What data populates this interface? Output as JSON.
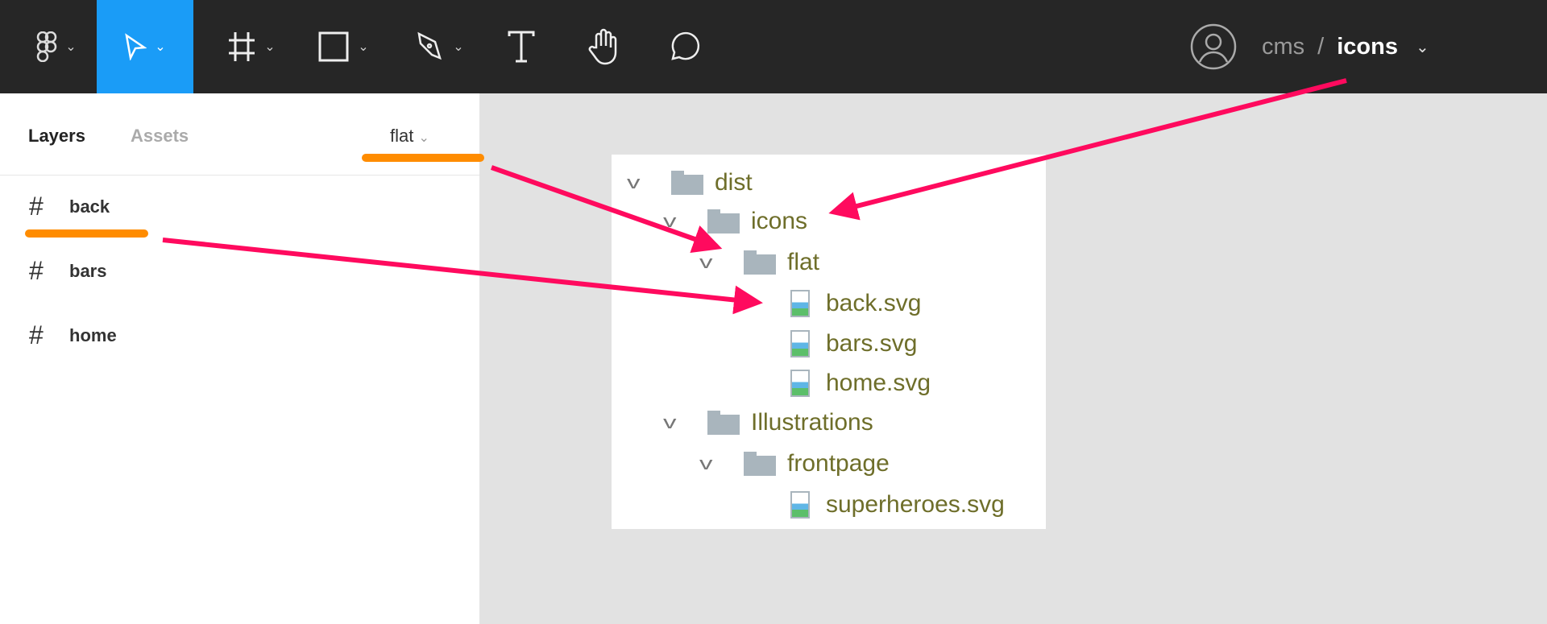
{
  "toolbar": {
    "tools": [
      {
        "name": "figma-menu",
        "icon": "figma-logo-icon"
      },
      {
        "name": "move",
        "icon": "cursor-icon",
        "active": true
      },
      {
        "name": "frame",
        "icon": "frame-hash-icon"
      },
      {
        "name": "rectangle",
        "icon": "rectangle-icon"
      },
      {
        "name": "pen",
        "icon": "pen-icon"
      },
      {
        "name": "text",
        "icon": "text-icon"
      },
      {
        "name": "hand",
        "icon": "hand-icon"
      },
      {
        "name": "comment",
        "icon": "comment-icon"
      }
    ],
    "accent": "#1a9cf7"
  },
  "breadcrumb": {
    "team": "cms",
    "separator": "/",
    "file": "icons"
  },
  "left_panel": {
    "tabs": {
      "layers": "Layers",
      "assets": "Assets"
    },
    "page_select": "flat",
    "layers": [
      "back",
      "bars",
      "home"
    ]
  },
  "file_tree": {
    "dist": "dist",
    "icons": "icons",
    "flat": "flat",
    "files_flat": [
      "back.svg",
      "bars.svg",
      "home.svg"
    ],
    "illustrations": "Illustrations",
    "frontpage": "frontpage",
    "files_frontpage": [
      "superheroes.svg"
    ]
  },
  "annotation_colors": {
    "arrow": "#ff0a5e",
    "underline": "#ff8c00"
  }
}
